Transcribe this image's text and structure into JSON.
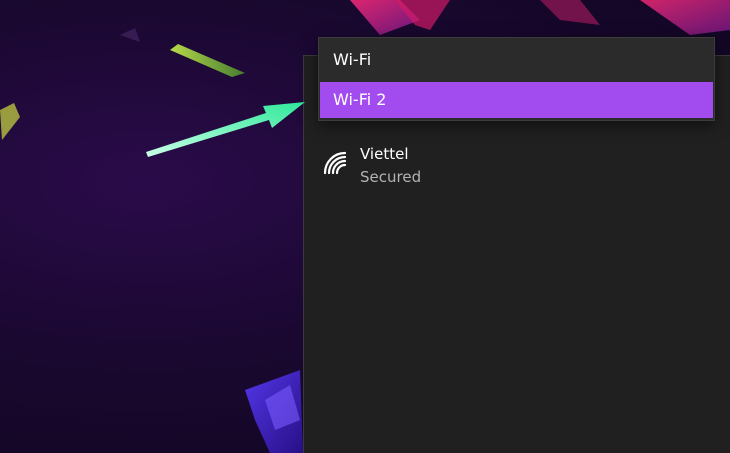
{
  "adapter_dropdown": {
    "options": [
      {
        "label": "Wi-Fi",
        "selected": false
      },
      {
        "label": "Wi-Fi 2",
        "selected": true
      }
    ],
    "selected_color": "#a24cf0"
  },
  "networks": [
    {
      "name": "Viettel",
      "status": "Secured",
      "icon": "wifi-signal-icon"
    }
  ],
  "annotation": {
    "arrow_color": "#2ee89a",
    "icon": "pointer-arrow"
  }
}
